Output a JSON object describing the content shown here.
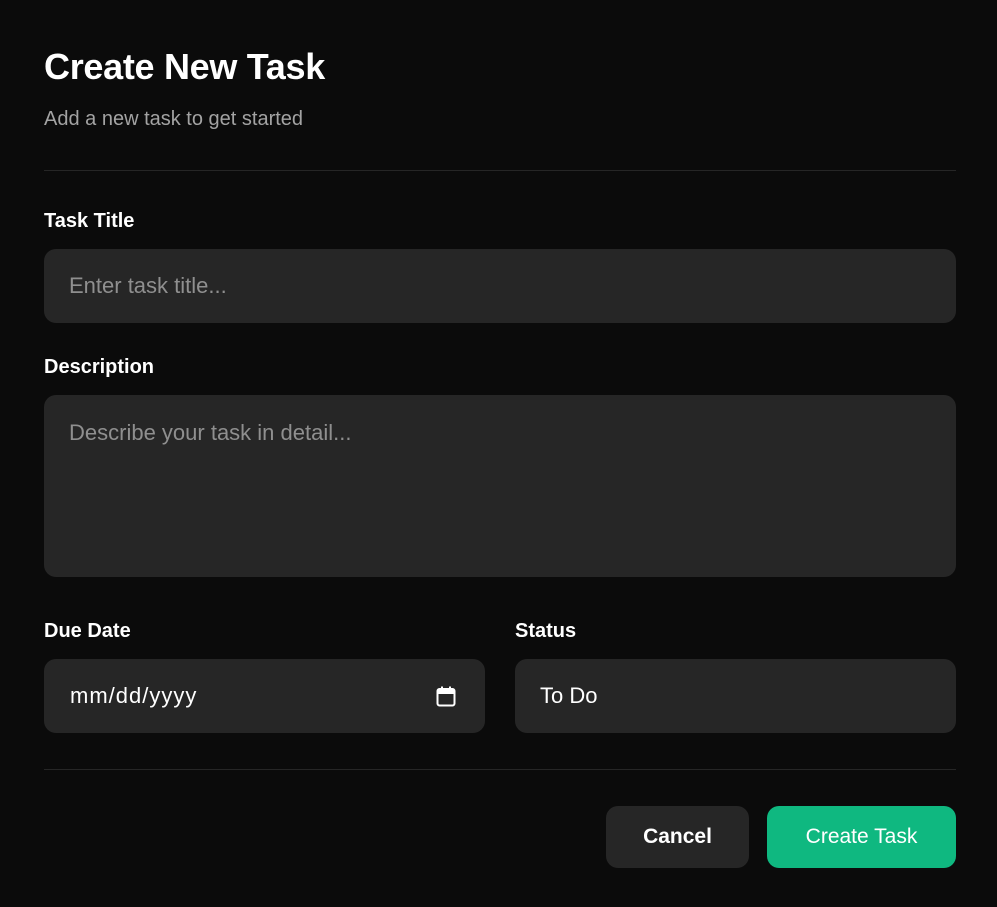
{
  "header": {
    "title": "Create New Task",
    "subtitle": "Add a new task to get started"
  },
  "form": {
    "task_title": {
      "label": "Task Title",
      "placeholder": "Enter task title...",
      "value": ""
    },
    "description": {
      "label": "Description",
      "placeholder": "Describe your task in detail...",
      "value": ""
    },
    "due_date": {
      "label": "Due Date",
      "display": "mm/dd/yyyy",
      "icon": "calendar-icon"
    },
    "status": {
      "label": "Status",
      "selected": "To Do"
    }
  },
  "actions": {
    "cancel_label": "Cancel",
    "create_label": "Create Task"
  },
  "colors": {
    "background": "#0b0b0b",
    "field_background": "#262626",
    "accent": "#0fb880",
    "muted_text": "#a3a3a3"
  }
}
